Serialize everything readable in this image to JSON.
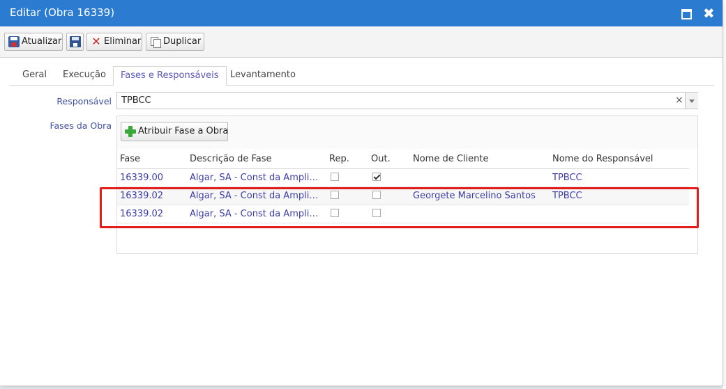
{
  "dialog": {
    "title": "Editar (Obra 16339)"
  },
  "toolbar": {
    "update_label": "Atualizar",
    "delete_label": "Eliminar",
    "duplicate_label": "Duplicar"
  },
  "tabs": [
    {
      "label": "Geral",
      "active": false
    },
    {
      "label": "Execução",
      "active": false
    },
    {
      "label": "Fases e Responsáveis",
      "active": true
    },
    {
      "label": "Levantamento",
      "active": false
    }
  ],
  "form": {
    "responsavel_label": "Responsável",
    "responsavel_value": "TPBCC",
    "fases_label": "Fases da Obra",
    "add_phase_label": "Atribuir Fase a Obra"
  },
  "grid": {
    "columns": [
      "Fase",
      "Descrição de Fase",
      "Rep.",
      "Out.",
      "Nome de Cliente",
      "Nome do Responsável"
    ],
    "rows": [
      {
        "fase": "16339.00",
        "descricao": "Algar, SA - Const da Ampliação",
        "rep": false,
        "out": true,
        "cliente": "",
        "responsavel": "TPBCC"
      },
      {
        "fase": "16339.02",
        "descricao": "Algar, SA - Const da Ampliação",
        "rep": false,
        "out": false,
        "cliente": "Georgete Marcelino Santos",
        "responsavel": "TPBCC"
      },
      {
        "fase": "16339.02",
        "descricao": "Algar, SA - Const da Ampliação",
        "rep": false,
        "out": false,
        "cliente": "",
        "responsavel": ""
      }
    ]
  },
  "colors": {
    "titlebar": "#2b7cd0",
    "link_text": "#3d3daa",
    "highlight": "#e21b1b"
  }
}
